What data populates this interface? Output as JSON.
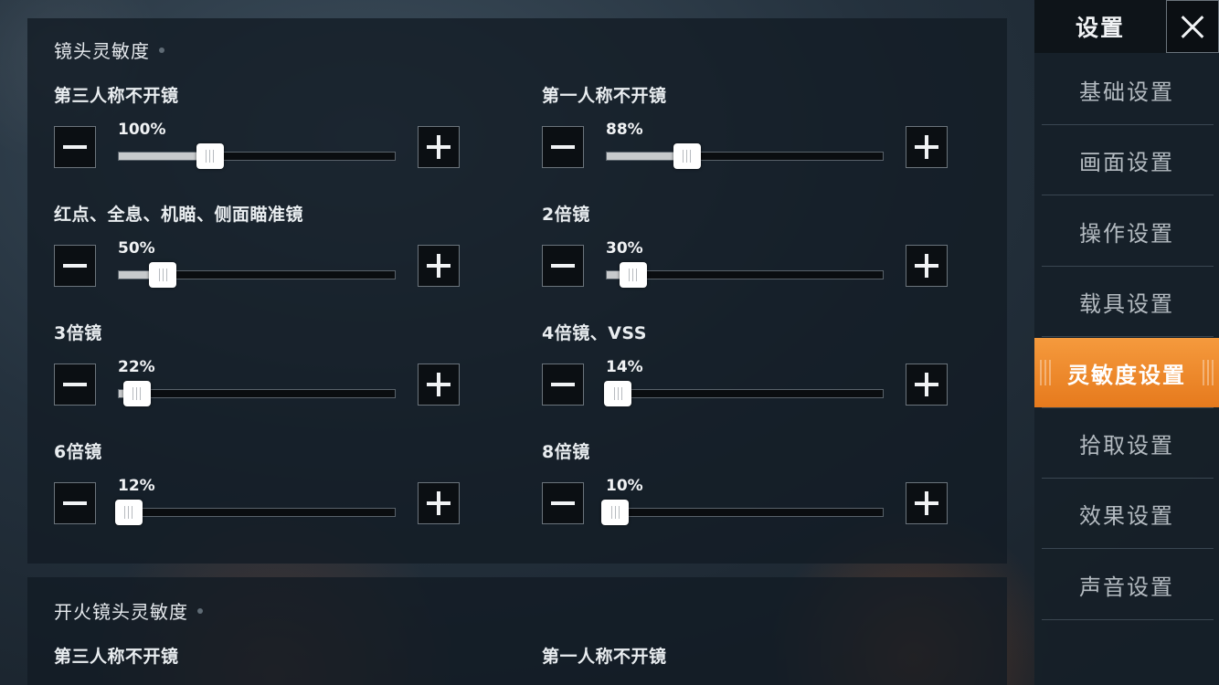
{
  "section1": {
    "title": "镜头灵敏度",
    "sliders": [
      {
        "label": "第三人称不开镜",
        "value": "100%",
        "fill": 0.33
      },
      {
        "label": "第一人称不开镜",
        "value": "88%",
        "fill": 0.29
      },
      {
        "label": "红点、全息、机瞄、侧面瞄准镜",
        "value": "50%",
        "fill": 0.16
      },
      {
        "label": "2倍镜",
        "value": "30%",
        "fill": 0.095
      },
      {
        "label": "3倍镜",
        "value": "22%",
        "fill": 0.065
      },
      {
        "label": "4倍镜、VSS",
        "value": "14%",
        "fill": 0.04
      },
      {
        "label": "6倍镜",
        "value": "12%",
        "fill": 0.035
      },
      {
        "label": "8倍镜",
        "value": "10%",
        "fill": 0.03
      }
    ]
  },
  "section2": {
    "title": "开火镜头灵敏度",
    "labels": [
      "第三人称不开镜",
      "第一人称不开镜"
    ]
  },
  "sidebar": {
    "title": "设置",
    "items": [
      {
        "label": "基础设置",
        "active": false
      },
      {
        "label": "画面设置",
        "active": false
      },
      {
        "label": "操作设置",
        "active": false
      },
      {
        "label": "载具设置",
        "active": false
      },
      {
        "label": "灵敏度设置",
        "active": true
      },
      {
        "label": "拾取设置",
        "active": false
      },
      {
        "label": "效果设置",
        "active": false
      },
      {
        "label": "声音设置",
        "active": false
      }
    ]
  },
  "colors": {
    "accent": "#f08a2c",
    "panel": "#121b24"
  }
}
